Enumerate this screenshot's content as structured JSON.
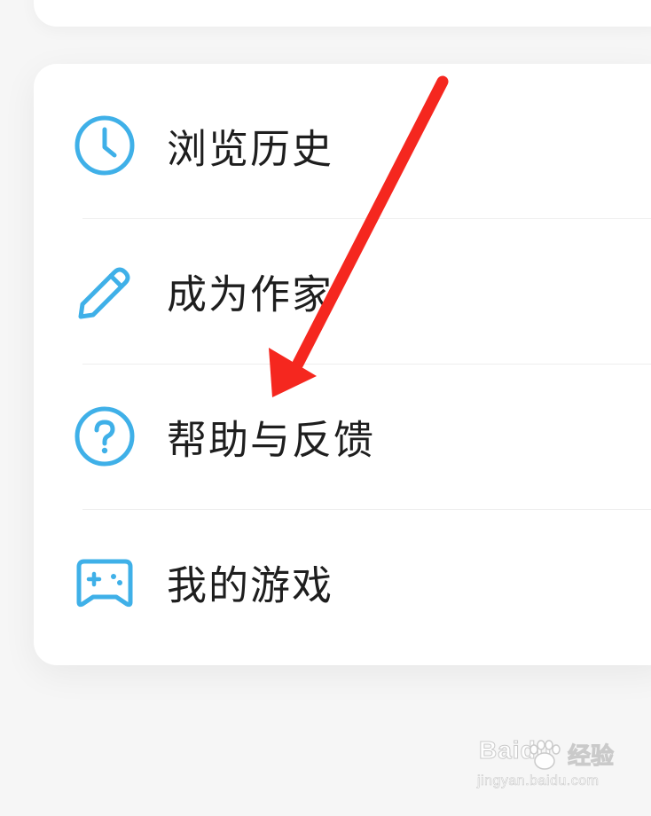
{
  "menu": {
    "items": [
      {
        "label": "浏览历史",
        "icon": "clock-icon"
      },
      {
        "label": "成为作家",
        "icon": "pencil-icon"
      },
      {
        "label": "帮助与反馈",
        "icon": "question-circle-icon"
      },
      {
        "label": "我的游戏",
        "icon": "gamepad-icon"
      }
    ]
  },
  "colors": {
    "icon": "#3fb0e8",
    "annotation_arrow": "#f5271f",
    "card": "#ffffff",
    "background": "#f6f6f6"
  },
  "watermark": {
    "brand": "Baidu",
    "cn": "经验",
    "url": "jingyan.baidu.com"
  }
}
